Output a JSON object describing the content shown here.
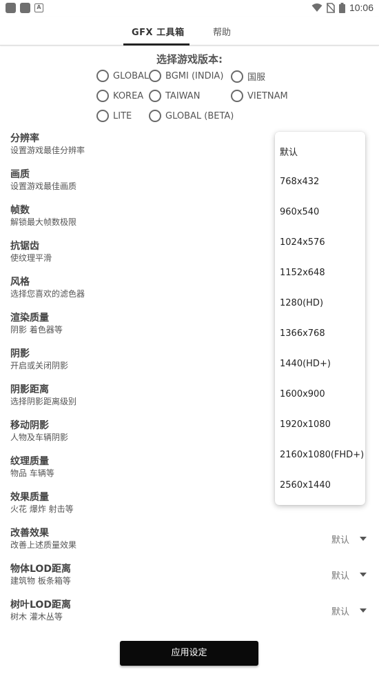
{
  "status_bar": {
    "time": "10:06",
    "notification_badge": "A",
    "icons": [
      "app-notification-icon",
      "app-notification-icon",
      "a-notification-icon",
      "wifi-icon",
      "no-sim-icon",
      "battery-icon"
    ]
  },
  "tabs": [
    {
      "label": "GFX 工具箱"
    },
    {
      "label": "帮助"
    }
  ],
  "version": {
    "title": "选择游戏版本:",
    "options": [
      "GLOBAL",
      "BGMI (INDIA)",
      "国服",
      "KOREA",
      "TAIWAN",
      "VIETNAM",
      "LITE",
      "GLOBAL (BETA)"
    ]
  },
  "settings": [
    {
      "title": "分辨率",
      "subtitle": "设置游戏最佳分辨率",
      "value": ""
    },
    {
      "title": "画质",
      "subtitle": "设置游戏最佳画质",
      "value": ""
    },
    {
      "title": "帧数",
      "subtitle": "解锁最大帧数极限",
      "value": ""
    },
    {
      "title": "抗锯齿",
      "subtitle": "使纹理平滑",
      "value": ""
    },
    {
      "title": "风格",
      "subtitle": "选择您喜欢的滤色器",
      "value": ""
    },
    {
      "title": "渲染质量",
      "subtitle": "阴影 着色器等",
      "value": ""
    },
    {
      "title": "阴影",
      "subtitle": "开启或关闭阴影",
      "value": ""
    },
    {
      "title": "阴影距离",
      "subtitle": "选择阴影距离级别",
      "value": ""
    },
    {
      "title": "移动阴影",
      "subtitle": "人物及车辆阴影",
      "value": ""
    },
    {
      "title": "纹理质量",
      "subtitle": "物品 车辆等",
      "value": ""
    },
    {
      "title": "效果质量",
      "subtitle": "火花 爆炸 射击等",
      "value": ""
    },
    {
      "title": "改善效果",
      "subtitle": "改善上述质量效果",
      "value": "默认"
    },
    {
      "title": "物体LOD距离",
      "subtitle": "建筑物 板条箱等",
      "value": "默认"
    },
    {
      "title": "树叶LOD距离",
      "subtitle": "树木 灌木丛等",
      "value": "默认"
    }
  ],
  "resolution_dropdown": {
    "options": [
      "默认",
      "768x432",
      "960x540",
      "1024x576",
      "1152x648",
      "1280(HD)",
      "1366x768",
      "1440(HD+)",
      "1600x900",
      "1920x1080",
      "2160x1080(FHD+)",
      "2560x1440"
    ]
  },
  "apply_button": {
    "label": "应用设定"
  },
  "colors": {
    "accent": "#0a0a0a",
    "tab_indicator": "#222222"
  }
}
